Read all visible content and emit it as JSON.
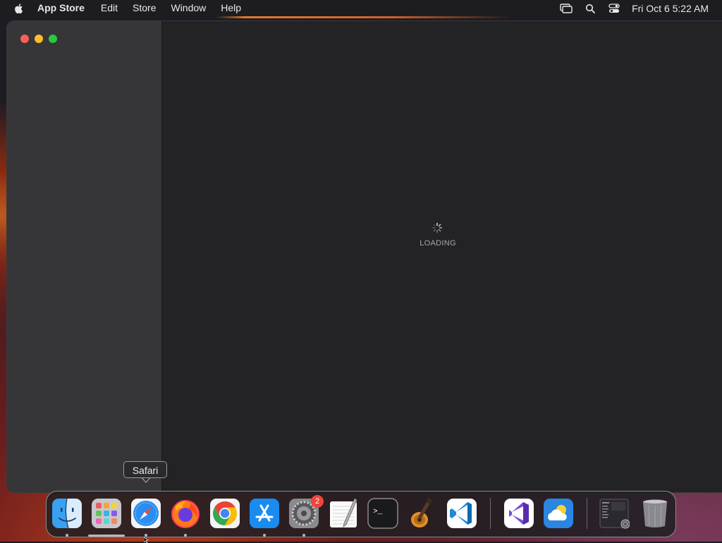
{
  "menubar": {
    "app_name": "App Store",
    "items": [
      "Edit",
      "Store",
      "Window",
      "Help"
    ],
    "clock": "Fri Oct 6  5:22 AM"
  },
  "window": {
    "loading_text": "LOADING"
  },
  "tooltip": {
    "text": "Safari"
  },
  "dock": {
    "apps": [
      {
        "name": "Finder",
        "icon": "finder-icon",
        "running": true
      },
      {
        "name": "Launchpad",
        "icon": "launchpad-icon",
        "running": false
      },
      {
        "name": "Safari",
        "icon": "safari-icon",
        "running": true
      },
      {
        "name": "Firefox",
        "icon": "firefox-icon",
        "running": true
      },
      {
        "name": "Google Chrome",
        "icon": "chrome-icon",
        "running": false
      },
      {
        "name": "App Store",
        "icon": "app-store-icon",
        "running": true
      },
      {
        "name": "System Settings",
        "icon": "system-settings-icon",
        "running": true,
        "badge": "2"
      },
      {
        "name": "TextEdit",
        "icon": "textedit-icon",
        "running": false
      },
      {
        "name": "Terminal",
        "icon": "terminal-icon",
        "running": false
      },
      {
        "name": "GarageBand",
        "icon": "garageband-icon",
        "running": false
      },
      {
        "name": "Visual Studio Code",
        "icon": "vscode-icon",
        "running": false
      },
      {
        "name": "Visual Studio",
        "icon": "visual-studio-icon",
        "running": false
      },
      {
        "name": "Weather",
        "icon": "weather-icon",
        "running": false
      },
      {
        "name": "Downloads",
        "icon": "downloads-stack-icon",
        "running": false
      },
      {
        "name": "Trash",
        "icon": "trash-icon",
        "running": false
      }
    ]
  },
  "colors": {
    "menubar_bg": "#1d1d20",
    "window_bg": "#232325",
    "sidebar_bg": "#363638",
    "close": "#fe5f57",
    "minimize": "#febc2e",
    "maximize": "#28c840",
    "badge": "#f0443a"
  }
}
